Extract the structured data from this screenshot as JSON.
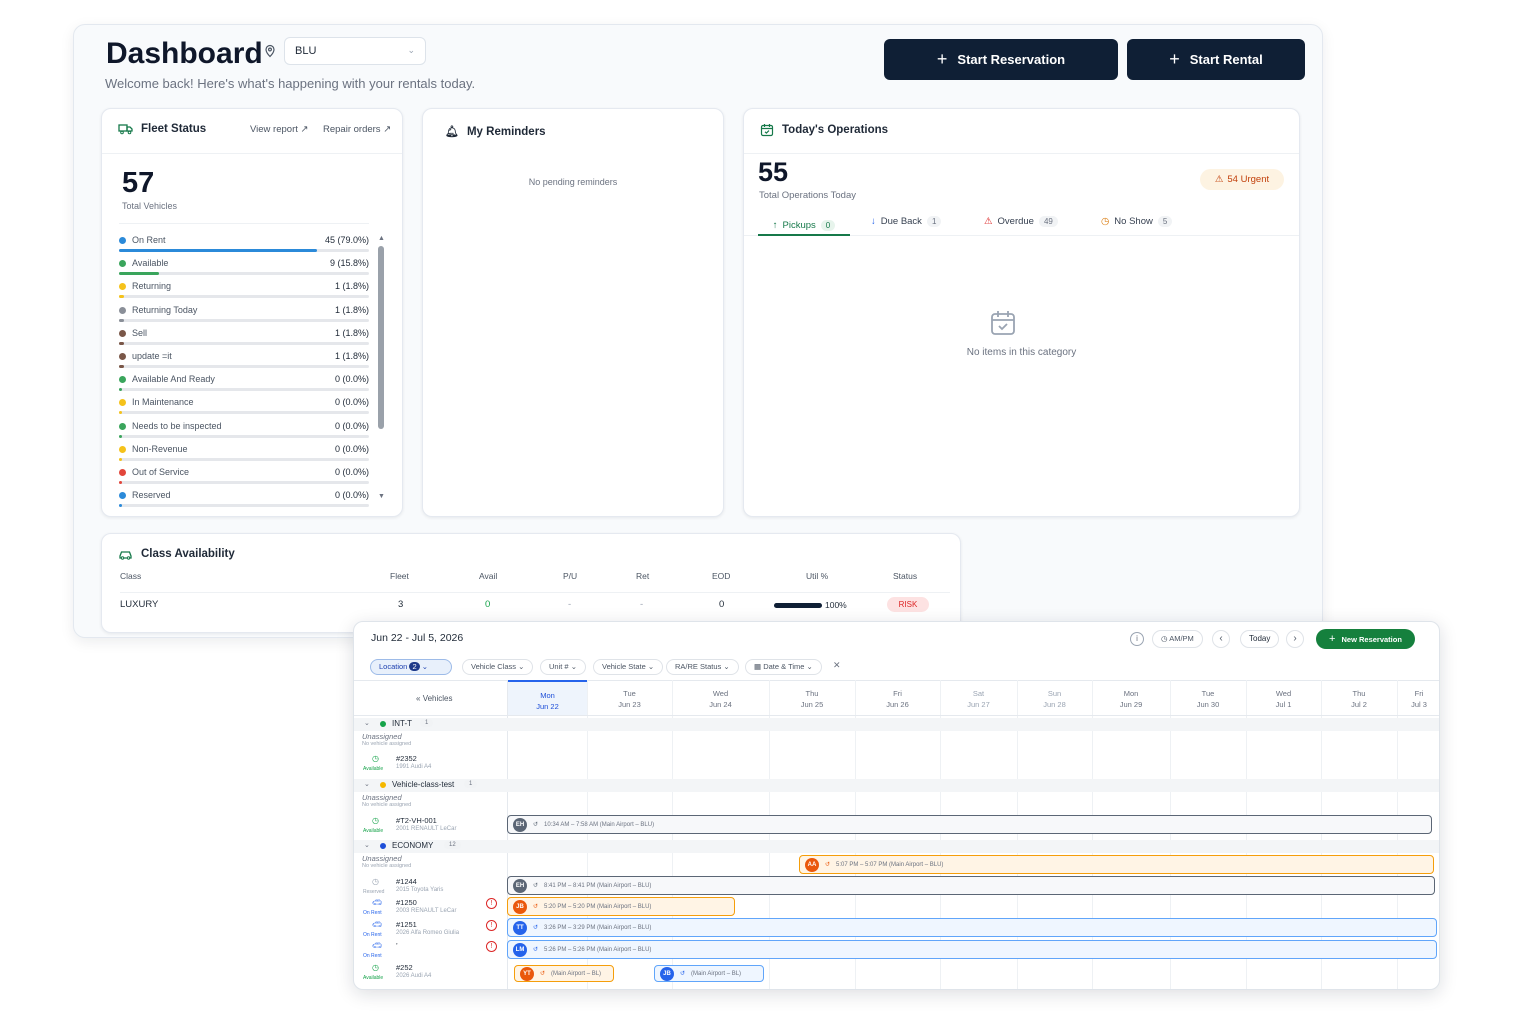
{
  "header": {
    "title": "Dashboard",
    "subtitle": "Welcome back! Here's what's happening with your rentals today.",
    "location": "BLU",
    "start_reservation": "Start Reservation",
    "start_rental": "Start Rental"
  },
  "fleet": {
    "title": "Fleet Status",
    "view_report": "View report",
    "repair_orders": "Repair orders",
    "total": "57",
    "total_label": "Total Vehicles",
    "rows": [
      {
        "label": "On Rent",
        "value": "45 (79.0%)",
        "pct": 79.0,
        "color": "#2b8ad9"
      },
      {
        "label": "Available",
        "value": "9 (15.8%)",
        "pct": 15.8,
        "color": "#3aa55c"
      },
      {
        "label": "Returning",
        "value": "1 (1.8%)",
        "pct": 1.8,
        "color": "#f5c21b"
      },
      {
        "label": "Returning Today",
        "value": "1 (1.8%)",
        "pct": 1.8,
        "color": "#8a8f98"
      },
      {
        "label": "Sell",
        "value": "1 (1.8%)",
        "pct": 1.8,
        "color": "#7a5748"
      },
      {
        "label": "update =it",
        "value": "1 (1.8%)",
        "pct": 1.8,
        "color": "#7a5748"
      },
      {
        "label": "Available And Ready",
        "value": "0 (0.0%)",
        "pct": 0,
        "color": "#3aa55c"
      },
      {
        "label": "In Maintenance",
        "value": "0 (0.0%)",
        "pct": 0,
        "color": "#f5c21b"
      },
      {
        "label": "Needs to be inspected",
        "value": "0 (0.0%)",
        "pct": 0,
        "color": "#3aa55c"
      },
      {
        "label": "Non-Revenue",
        "value": "0 (0.0%)",
        "pct": 0,
        "color": "#f5c21b"
      },
      {
        "label": "Out of Service",
        "value": "0 (0.0%)",
        "pct": 0,
        "color": "#e2463b"
      },
      {
        "label": "Reserved",
        "value": "0 (0.0%)",
        "pct": 0,
        "color": "#2b8ad9"
      }
    ]
  },
  "reminders": {
    "title": "My Reminders",
    "empty": "No pending reminders"
  },
  "ops": {
    "title": "Today's Operations",
    "total": "55",
    "total_label": "Total Operations Today",
    "urgent": "54 Urgent",
    "tabs": [
      {
        "label": "Pickups",
        "count": "0"
      },
      {
        "label": "Due Back",
        "count": "1"
      },
      {
        "label": "Overdue",
        "count": "49"
      },
      {
        "label": "No Show",
        "count": "5"
      }
    ],
    "empty": "No items in this category"
  },
  "class_avail": {
    "title": "Class Availability",
    "headers": [
      "Class",
      "Fleet",
      "Avail",
      "P/U",
      "Ret",
      "EOD",
      "Util %",
      "Status"
    ],
    "row": {
      "class": "LUXURY",
      "fleet": "3",
      "avail": "0",
      "pu": "-",
      "ret": "-",
      "eod": "0",
      "util": "100%",
      "util_pct": 100,
      "status": "RISK"
    }
  },
  "calendar": {
    "range": "Jun 22 - Jul 5, 2026",
    "ampm": "AM/PM",
    "today": "Today",
    "new_res": "New Reservation",
    "filters": {
      "location": "Location",
      "location_count": "2",
      "vehicle_class": "Vehicle Class",
      "unit": "Unit #",
      "vehicle_state": "Vehicle State",
      "rare": "RA/RE Status",
      "datetime": "Date & Time"
    },
    "vehicles_label": "Vehicles",
    "days": [
      [
        "Mon",
        "Jun 22"
      ],
      [
        "Tue",
        "Jun 23"
      ],
      [
        "Wed",
        "Jun 24"
      ],
      [
        "Thu",
        "Jun 25"
      ],
      [
        "Fri",
        "Jun 26"
      ],
      [
        "Sat",
        "Jun 27"
      ],
      [
        "Sun",
        "Jun 28"
      ],
      [
        "Mon",
        "Jun 29"
      ],
      [
        "Tue",
        "Jun 30"
      ],
      [
        "Wed",
        "Jul 1"
      ],
      [
        "Thu",
        "Jul 2"
      ],
      [
        "Fri",
        "Jul 3"
      ]
    ],
    "groups": [
      {
        "name": "INT-T",
        "count": "1"
      },
      {
        "name": "Vehicle-class-test",
        "count": "1"
      },
      {
        "name": "ECONOMY",
        "count": "12"
      }
    ],
    "unassigned": "Unassigned",
    "no_vehicle": "No vehicle assigned",
    "vehicles": [
      {
        "unit": "#2352",
        "model": "1991 Audi A4",
        "state": "Available"
      },
      {
        "unit": "#T2-VH-001",
        "model": "2001 RENAULT LeCar",
        "state": "Available"
      },
      {
        "unit": "#1244",
        "model": "2015 Toyota Yaris",
        "state": "Reserved"
      },
      {
        "unit": "#1250",
        "model": "2003 RENAULT LeCar",
        "state": "On Rent"
      },
      {
        "unit": "#1251",
        "model": "2026 Alfa Romeo Giulia",
        "state": "On Rent"
      },
      {
        "unit": "’",
        "model": "",
        "state": "On Rent"
      },
      {
        "unit": "#252",
        "model": "2026 Audi A4",
        "state": "Available"
      }
    ],
    "bars": [
      {
        "initials": "EH",
        "text": "10:34 AM – 7:58 AM   (Main Airport – BLU)"
      },
      {
        "initials": "AA",
        "text": "5:07 PM – 5:07 PM   (Main Airport – BLU)"
      },
      {
        "initials": "EH",
        "text": "8:41 PM – 8:41 PM   (Main Airport – BLU)"
      },
      {
        "initials": "JB",
        "text": "5:20 PM – 5:20 PM   (Main Airport – BLU)"
      },
      {
        "initials": "TT",
        "text": "3:26 PM – 3:29 PM   (Main Airport – BLU)"
      },
      {
        "initials": "LM",
        "text": "5:26 PM – 5:26 PM   (Main Airport – BLU)"
      },
      {
        "initials": "YT",
        "text": "(Main Airport – BL)"
      },
      {
        "initials": "JB",
        "text": "(Main Airport – BL)"
      }
    ]
  }
}
